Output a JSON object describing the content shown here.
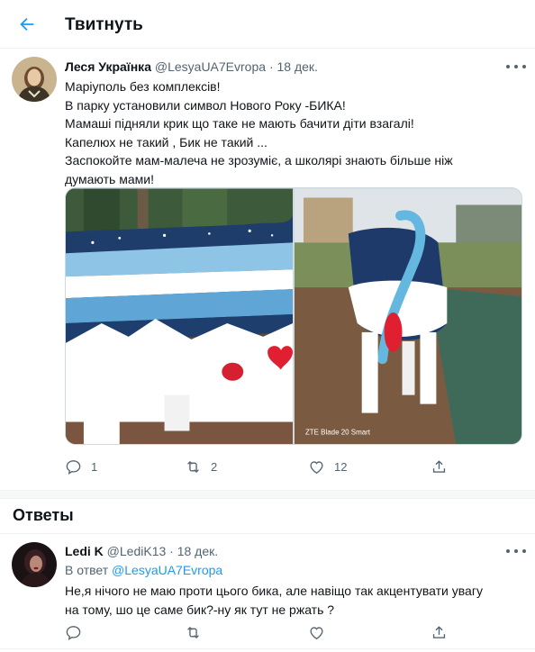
{
  "header": {
    "title": "Твитнуть",
    "back_icon": "arrow-left-icon"
  },
  "tweet": {
    "author_name": "Леся Українка",
    "handle": "@LesyaUA7Evropa",
    "separator": "·",
    "date": "18 дек.",
    "text_lines": [
      "Маріуполь без комплексів!",
      "В парку установили символ Нового Року -БИКА!",
      "Мамаші підняли крик що таке не мають бачити діти взагалі!",
      "Капелюх не такий , Бик не такий ...",
      "Заспокойте мам-малеча не зрозуміє, а школярі знають більше ніж",
      "думають мами!"
    ],
    "photo_watermark": "ZTE Blade 20 Smart",
    "counts": {
      "replies": "1",
      "retweets": "2",
      "likes": "12"
    }
  },
  "answers_title": "Ответы",
  "reply": {
    "author_name": "Ledi K",
    "handle": "@LediK13",
    "separator": "·",
    "date": "18 дек.",
    "reply_to_label": "В ответ",
    "reply_to_handle": "@LesyaUA7Evropa",
    "text_lines": [
      "Не,я нічого не маю проти цього бика, але навіщо так акцентувати увагу",
      "на тому, шо це саме бик?-ну як тут не ржать ?"
    ]
  },
  "colors": {
    "accent": "#1d9bf0",
    "text": "#0f1419",
    "secondary": "#536471",
    "border": "#eff3f4"
  }
}
